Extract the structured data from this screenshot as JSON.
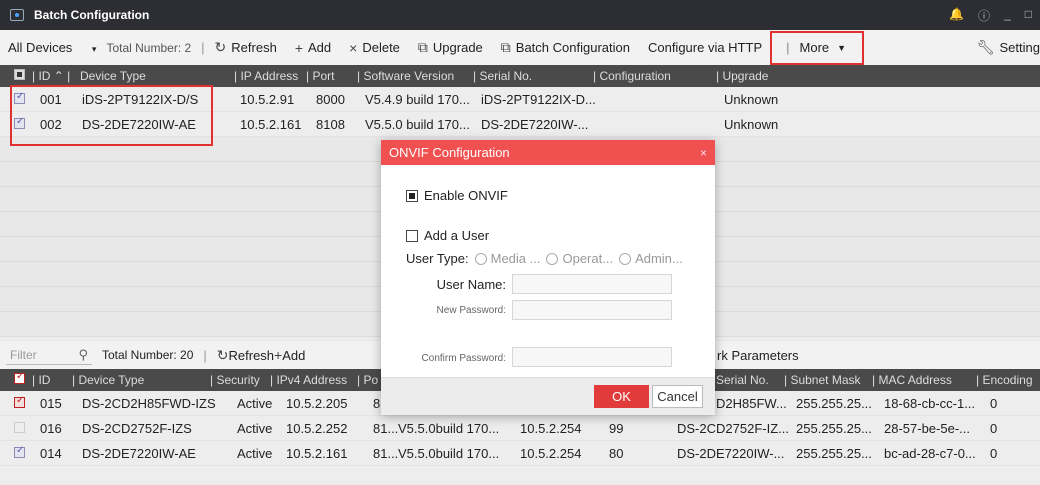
{
  "window": {
    "title": "Batch Configuration",
    "controls": [
      "🔔",
      "ⓘ",
      "_",
      "□"
    ]
  },
  "toolbar": {
    "scope": "All Devices",
    "total": "Total Number: 2",
    "refresh": "Refresh",
    "add": "Add",
    "delete": "Delete",
    "upgrade": "Upgrade",
    "batch_config": "Batch Configuration",
    "configure_http": "Configure via HTTP",
    "more": "More",
    "settings": "Setting"
  },
  "top_table": {
    "headers": [
      "ID",
      "Device Type",
      "IP Address",
      "Port",
      "Software Version",
      "Serial No.",
      "Configuration",
      "Upgrade"
    ],
    "rows": [
      {
        "id": "001",
        "type": "iDS-2PT9122IX-D/S",
        "ip": "10.5.2.91",
        "port": "8000",
        "version": "V5.4.9 build 170...",
        "serial": "iDS-2PT9122IX-D...",
        "config": "",
        "upgrade": "Unknown"
      },
      {
        "id": "002",
        "type": "DS-2DE7220IW-AE",
        "ip": "10.5.2.161",
        "port": "8108",
        "version": "V5.5.0 build 170...",
        "serial": "DS-2DE7220IW-...",
        "config": "",
        "upgrade": "Unknown"
      }
    ]
  },
  "bottom_toolbar": {
    "filter_placeholder": "Filter",
    "total": "Total Number: 20",
    "refresh": "Refresh",
    "add": "Add",
    "network_params": "rk Parameters"
  },
  "bottom_table": {
    "headers": [
      "ID",
      "Device Type",
      "Security",
      "IPv4 Address",
      "Po",
      "Serial No.",
      "Subnet Mask",
      "MAC Address",
      "Encoding"
    ],
    "rows": [
      {
        "id": "015",
        "type": "DS-2CD2H85FWD-IZS",
        "security": "Active",
        "ip": "10.5.2.205",
        "port": "8",
        "version": "",
        "gateway": "",
        "http": "",
        "serial": "D2H85FW...",
        "mask": "255.255.25...",
        "mac": "18-68-cb-cc-1...",
        "enc": "0"
      },
      {
        "id": "016",
        "type": "DS-2CD2752F-IZS",
        "security": "Active",
        "ip": "10.5.2.252",
        "port": "81...",
        "version": "V5.5.0build 170...",
        "gateway": "10.5.2.254",
        "http": "99",
        "serial": "DS-2CD2752F-IZ...",
        "mask": "255.255.25...",
        "mac": "28-57-be-5e-...",
        "enc": "0"
      },
      {
        "id": "014",
        "type": "DS-2DE7220IW-AE",
        "security": "Active",
        "ip": "10.5.2.161",
        "port": "81...",
        "version": "V5.5.0build 170...",
        "gateway": "10.5.2.254",
        "http": "80",
        "serial": "DS-2DE7220IW-...",
        "mask": "255.255.25...",
        "mac": "bc-ad-28-c7-0...",
        "enc": "0"
      }
    ]
  },
  "modal": {
    "title": "ONVIF Configuration",
    "close": "×",
    "enable_onvif": "Enable ONVIF",
    "add_user": "Add a User",
    "user_type_label": "User Type:",
    "user_types": [
      "Media ...",
      "Operat...",
      "Admin..."
    ],
    "username_label": "User Name:",
    "new_password_label": "New Password:",
    "confirm_password_label": "Confirm Password:",
    "ok": "OK",
    "cancel": "Cancel"
  },
  "colors": {
    "accent": "#e23b3b",
    "title_bg": "#2d2e33",
    "header_bg": "#4a4a4a"
  }
}
